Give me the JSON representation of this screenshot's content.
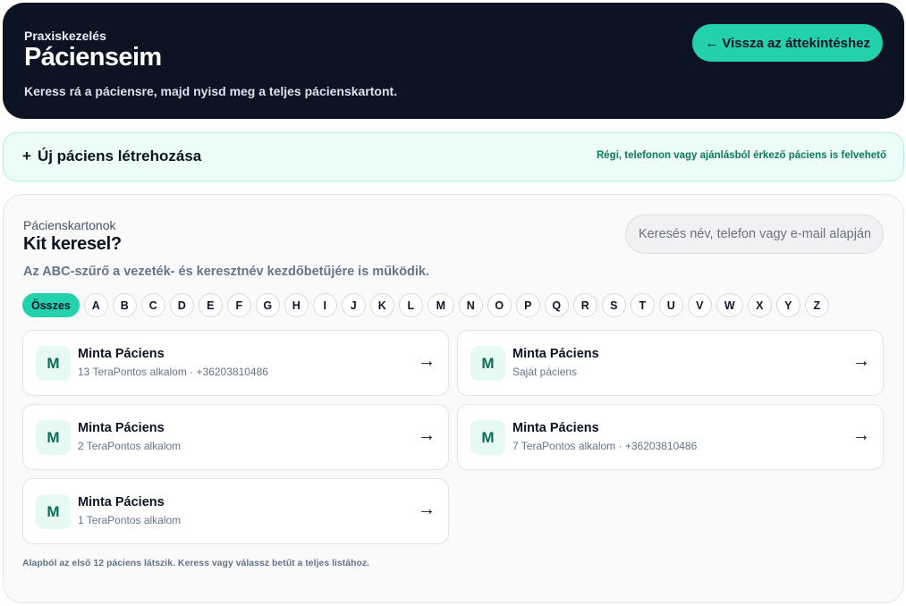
{
  "header": {
    "eyebrow": "Praxiskezelés",
    "title": "Pácienseim",
    "subtitle": "Keress rá a páciensre, majd nyisd meg a teljes pácienskartont.",
    "back_button": "Vissza az áttekintéshez",
    "back_icon": "←"
  },
  "new_patient": {
    "plus": "+",
    "label": "Új páciens létrehozása",
    "hint": "Régi, telefonon vagy ajánlásból érkező páciens is felvehető"
  },
  "panel": {
    "label": "Pácienskartonok",
    "heading": "Kit keresel?",
    "helper": "Az ABC-szűrő a vezeték- és keresztnév kezdőbetűjére is működik.",
    "search_placeholder": "Keresés név, telefon vagy e-mail alapján.",
    "letters": [
      "Összes",
      "A",
      "B",
      "C",
      "D",
      "E",
      "F",
      "G",
      "H",
      "I",
      "J",
      "K",
      "L",
      "M",
      "N",
      "O",
      "P",
      "Q",
      "R",
      "S",
      "T",
      "U",
      "V",
      "W",
      "X",
      "Y",
      "Z"
    ],
    "selected_letter": "Összes",
    "footnote": "Alapból az első 12 páciens látszik. Keress vagy válassz betűt a teljes listához."
  },
  "patients": [
    {
      "initial": "M",
      "name": "Minta Páciens",
      "meta": "13 TeraPontos alkalom · +36203810486",
      "arrow": "→"
    },
    {
      "initial": "M",
      "name": "Minta Páciens",
      "meta": "Saját páciens",
      "arrow": "→"
    },
    {
      "initial": "M",
      "name": "Minta Páciens",
      "meta": "2 TeraPontos alkalom",
      "arrow": "→"
    },
    {
      "initial": "M",
      "name": "Minta Páciens",
      "meta": "7 TeraPontos alkalom · +36203810486",
      "arrow": "→"
    },
    {
      "initial": "M",
      "name": "Minta Páciens",
      "meta": "1 TeraPontos alkalom",
      "arrow": "→"
    }
  ],
  "colors": {
    "accent": "#23d1ad",
    "header_bg": "#0c1322",
    "mint_bg": "#ecfdf7",
    "hint_text": "#0b7a5f"
  }
}
